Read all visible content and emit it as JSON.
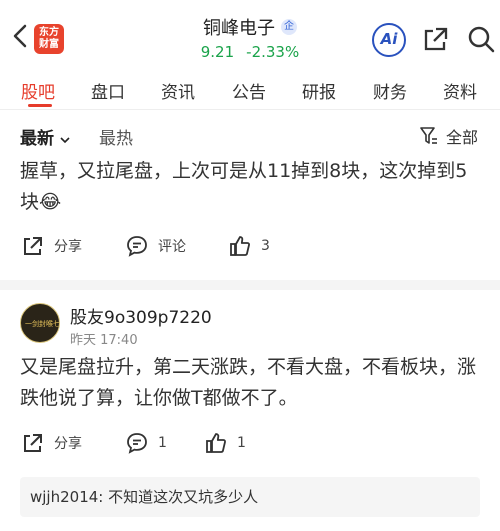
{
  "header": {
    "logo_line1": "东方",
    "logo_line2": "财富",
    "stock_name": "铜峰电子",
    "badge": "企",
    "price": "9.21",
    "change": "-2.33%",
    "ai_label": "Ai"
  },
  "tabs": [
    "股吧",
    "盘口",
    "资讯",
    "公告",
    "研报",
    "财务",
    "资料"
  ],
  "filter": {
    "latest": "最新",
    "hot": "最热",
    "all": "全部"
  },
  "post1": {
    "text": "握草，又拉尾盘，上次可是从11掉到8块，这次掉到5块",
    "emoji": "😂",
    "share": "分享",
    "comment": "评论",
    "likes": "3"
  },
  "post2": {
    "avatar_text": "一剑封喉七步断",
    "user": "股友9o309p7220",
    "time": "昨天 17:40",
    "text": "又是尾盘拉升，第二天涨跌，不看大盘，不看板块，涨跌他说了算，让你做T都做不了。",
    "share": "分享",
    "comments": "1",
    "likes": "1"
  },
  "reply": {
    "user": "wjjh2014:",
    "text": "不知道这次又坑多少人"
  },
  "colors": {
    "accent": "#e63c2b",
    "down": "#1aa34a",
    "ai": "#2a52be"
  }
}
